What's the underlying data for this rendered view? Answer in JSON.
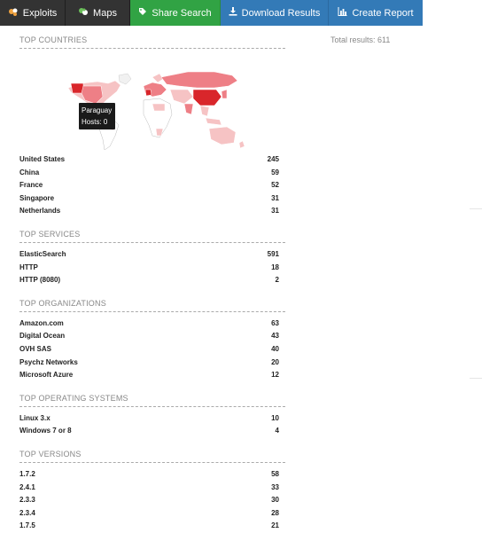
{
  "nav": {
    "exploits": "Exploits",
    "maps": "Maps",
    "share": "Share Search",
    "download": "Download Results",
    "report": "Create Report"
  },
  "total_results": "Total results: 611",
  "sections": {
    "countries": {
      "title": "TOP COUNTRIES",
      "rows": [
        {
          "name": "United States",
          "count": "245"
        },
        {
          "name": "China",
          "count": "59"
        },
        {
          "name": "France",
          "count": "52"
        },
        {
          "name": "Singapore",
          "count": "31"
        },
        {
          "name": "Netherlands",
          "count": "31"
        }
      ]
    },
    "services": {
      "title": "TOP SERVICES",
      "rows": [
        {
          "name": "ElasticSearch",
          "count": "591"
        },
        {
          "name": "HTTP",
          "count": "18"
        },
        {
          "name": "HTTP (8080)",
          "count": "2"
        }
      ]
    },
    "organizations": {
      "title": "TOP ORGANIZATIONS",
      "rows": [
        {
          "name": "Amazon.com",
          "count": "63"
        },
        {
          "name": "Digital Ocean",
          "count": "43"
        },
        {
          "name": "OVH SAS",
          "count": "40"
        },
        {
          "name": "Psychz Networks",
          "count": "20"
        },
        {
          "name": "Microsoft Azure",
          "count": "12"
        }
      ]
    },
    "os": {
      "title": "TOP OPERATING SYSTEMS",
      "rows": [
        {
          "name": "Linux 3.x",
          "count": "10"
        },
        {
          "name": "Windows 7 or 8",
          "count": "4"
        }
      ]
    },
    "versions": {
      "title": "TOP VERSIONS",
      "rows": [
        {
          "name": "1.7.2",
          "count": "58"
        },
        {
          "name": "2.4.1",
          "count": "33"
        },
        {
          "name": "2.3.3",
          "count": "30"
        },
        {
          "name": "2.3.4",
          "count": "28"
        },
        {
          "name": "1.7.5",
          "count": "21"
        }
      ]
    }
  },
  "map_tooltip": {
    "country": "Paraguay",
    "hosts": "Hosts: 0"
  },
  "colors": {
    "dark_nav": "#333333",
    "share_green": "#31a344",
    "blue": "#337ab7",
    "map_dark": "#d9262b",
    "map_mid": "#ee7f86",
    "map_light": "#f6c3c4"
  },
  "icons": {
    "exploits": "bug-icon",
    "maps": "globe-icon",
    "share": "tag-icon",
    "download": "download-icon",
    "report": "bar-chart-icon"
  }
}
